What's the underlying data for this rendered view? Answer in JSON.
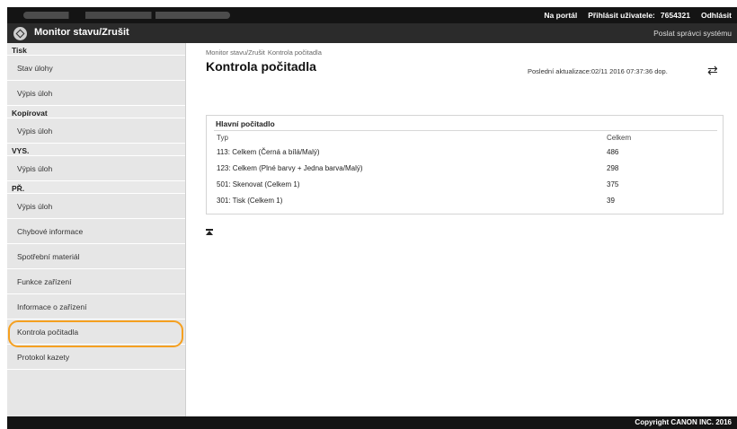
{
  "header": {
    "portal_link": "Na portál",
    "login_label": "Přihlásit uživatele:",
    "user_id": "7654321",
    "logout": "Odhlásit",
    "app_title": "Monitor stavu/Zrušit",
    "send_admin": "Poslat správci systému"
  },
  "sidebar": {
    "sections": [
      {
        "title": "Tisk",
        "items": [
          "Stav úlohy",
          "Výpis úloh"
        ]
      },
      {
        "title": "Kopírovat",
        "items": [
          "Výpis úloh"
        ]
      },
      {
        "title": "VYS.",
        "items": [
          "Výpis úloh"
        ]
      },
      {
        "title": "PŘ.",
        "items": [
          "Výpis úloh",
          "Chybové informace",
          "Spotřební materiál",
          "Funkce zařízení",
          "Informace o zařízení",
          "Kontrola počitadla",
          "Protokol kazety"
        ]
      }
    ],
    "active_item": "Kontrola počitadla"
  },
  "main": {
    "breadcrumb_home": "Monitor stavu/Zrušit",
    "breadcrumb_current": "Kontrola počitadla",
    "title": "Kontrola počitadla",
    "last_updated": "Poslední aktualizace:02/11 2016 07:37:36 dop.",
    "panel_title": "Hlavní počitadlo",
    "col_type": "Typ",
    "col_total": "Celkem",
    "rows": [
      {
        "type": "113: Celkem (Černá a bílá/Malý)",
        "total": "486"
      },
      {
        "type": "123: Celkem (Plné barvy + Jedna barva/Malý)",
        "total": "298"
      },
      {
        "type": "501: Skenovat (Celkem 1)",
        "total": "375"
      },
      {
        "type": "301: Tisk (Celkem 1)",
        "total": "39"
      }
    ]
  },
  "footer": {
    "copyright": "Copyright CANON INC. 2016"
  },
  "icons": {
    "logo": "canon-logo-icon",
    "refresh": "refresh-icon",
    "back_to_top": "back-to-top-icon"
  },
  "colors": {
    "topbar": "#141414",
    "titlebar": "#2b2b2b",
    "sidebar": "#e6e6e6",
    "highlight": "#f5a020"
  }
}
